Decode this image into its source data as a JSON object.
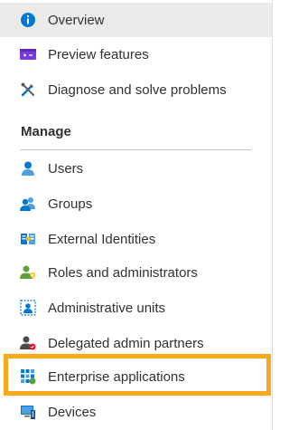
{
  "nav": {
    "items_top": [
      {
        "label": "Overview",
        "icon": "info-icon",
        "selected": true
      },
      {
        "label": "Preview features",
        "icon": "preview-features-icon"
      },
      {
        "label": "Diagnose and solve problems",
        "icon": "tools-icon"
      }
    ],
    "section": {
      "title": "Manage",
      "items": [
        {
          "label": "Users",
          "icon": "user-icon"
        },
        {
          "label": "Groups",
          "icon": "groups-icon"
        },
        {
          "label": "External Identities",
          "icon": "external-identities-icon"
        },
        {
          "label": "Roles and administrators",
          "icon": "roles-icon"
        },
        {
          "label": "Administrative units",
          "icon": "admin-units-icon"
        },
        {
          "label": "Delegated admin partners",
          "icon": "delegated-admin-icon"
        },
        {
          "label": "Enterprise applications",
          "icon": "enterprise-apps-icon",
          "highlighted": true
        },
        {
          "label": "Devices",
          "icon": "devices-icon"
        }
      ]
    }
  },
  "colors": {
    "selected_bg": "#edebe9",
    "highlight": "#f7a81b",
    "azure_blue": "#0078d4"
  }
}
